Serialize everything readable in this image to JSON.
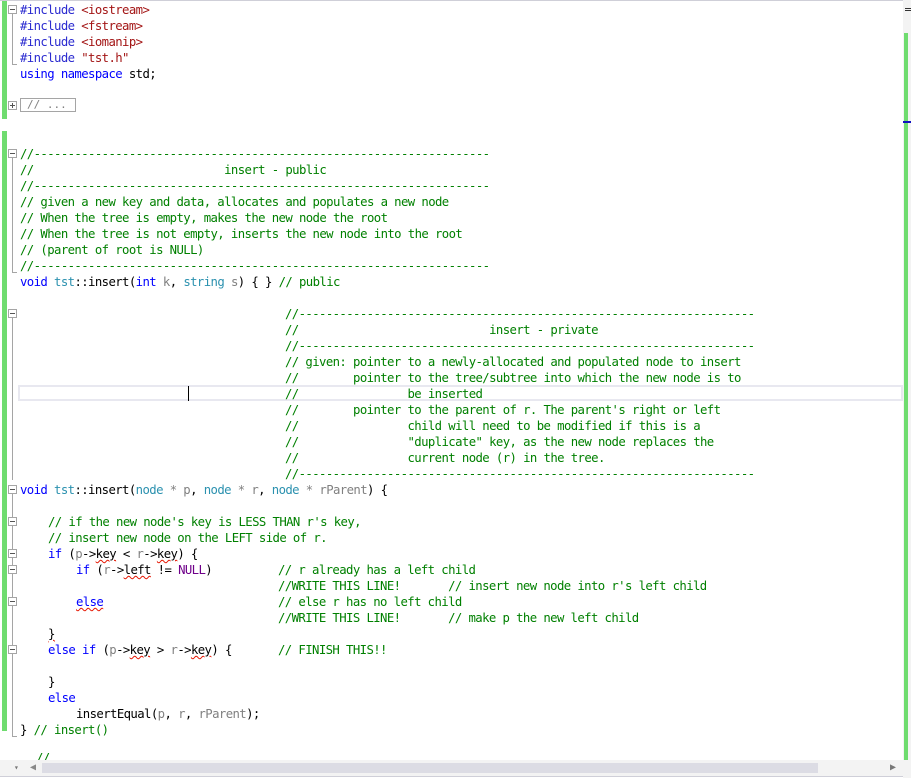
{
  "editor": {
    "language": "C++",
    "collapsed_region_label": "// ...",
    "lines": {
      "inc1_kw": "#include ",
      "inc1_hdr": "<iostream>",
      "inc2_kw": "#include ",
      "inc2_hdr": "<fstream>",
      "inc3_kw": "#include ",
      "inc3_hdr": "<iomanip>",
      "inc4_kw": "#include ",
      "inc4_hdr": "\"tst.h\"",
      "using_kw": "using namespace",
      "using_rest": " std;",
      "pub_rule1": "//-------------------------------------------------------------------",
      "pub_title": "//                            insert - public",
      "pub_rule2": "//-------------------------------------------------------------------",
      "pub_c1": "// given a new key and data, allocates and populates a new node",
      "pub_c2": "// When the tree is empty, makes the new node the root",
      "pub_c3": "// When the tree is not empty, inserts the new node into the root",
      "pub_c4": "// (parent of root is NULL)",
      "pub_rule3": "//-------------------------------------------------------------------",
      "pub_sig_void": "void",
      "pub_sig_cls": " tst",
      "pub_sig_fn": "::insert(",
      "pub_sig_int": "int",
      "pub_sig_k": " k",
      "pub_sig_comma": ", ",
      "pub_sig_string": "string",
      "pub_sig_s": " s",
      "pub_sig_end": ") { } ",
      "pub_sig_cm": "// public",
      "priv_rule1": "//-------------------------------------------------------------------",
      "priv_title": "//                            insert - private",
      "priv_rule2": "//-------------------------------------------------------------------",
      "priv_c1": "// given: pointer to a newly-allocated and populated node to insert",
      "priv_c2": "//        pointer to the tree/subtree into which the new node is to",
      "priv_c3": "//                be inserted",
      "priv_c4": "//        pointer to the parent of r. The parent's right or left",
      "priv_c5": "//                child will need to be modified if this is a",
      "priv_c6": "//                \"duplicate\" key, as the new node replaces the",
      "priv_c7": "//                current node (r) in the tree.",
      "priv_rule3": "//-------------------------------------------------------------------",
      "priv_sig": {
        "void": "void",
        "cls": " tst",
        "fn": "::insert(",
        "t1": "node",
        "p1": " * p",
        "c1": ", ",
        "t2": "node",
        "p2": " * r",
        "c2": ", ",
        "t3": "node",
        "p3": " * rParent",
        "end": ") {"
      },
      "body_c1": "// if the new node's key is LESS THAN r's key,",
      "body_c2": "// insert new node on the LEFT side of r.",
      "if1": {
        "kw": "if",
        "a": " (",
        "p": "p",
        "arrow1": "->",
        "key1": "key",
        "lt": " < ",
        "r": "r",
        "arrow2": "->",
        "key2": "key",
        "end": ") {"
      },
      "if2": {
        "kw": "if",
        "a": " (",
        "r": "r",
        "arrow": "->",
        "left": "left",
        "ne": " != ",
        "null": "NULL",
        "end": ")",
        "pad": "          ",
        "cm": "// r already has a left child"
      },
      "write1": "//WRITE THIS LINE!       // insert new node into r's left child",
      "else1": {
        "kw": "else",
        "cm": "// else r has no left child"
      },
      "write2": "//WRITE THIS LINE!       // make p the new left child",
      "close1": "}",
      "elseif": {
        "kw1": "else",
        "kw2": "if",
        "a": " (",
        "p": "p",
        "arrow1": "->",
        "key1": "key",
        "gt": " > ",
        "r": "r",
        "arrow2": "->",
        "key2": "key",
        "end": ") {",
        "cm": "// FINISH THIS!!"
      },
      "close2": "}",
      "else2": "else",
      "call": {
        "fn": "insertEqual(",
        "p": "p",
        "c1": ", ",
        "r": "r",
        "c2": ", ",
        "rp": "rParent",
        "end": ");"
      },
      "final_brace": "} ",
      "final_cm": "// insert()",
      "partial": "//"
    }
  },
  "scrollbars": {
    "zoom_dropdown_icon": "▾",
    "scroll_left_icon": "◀",
    "scroll_right_icon": "▶"
  }
}
